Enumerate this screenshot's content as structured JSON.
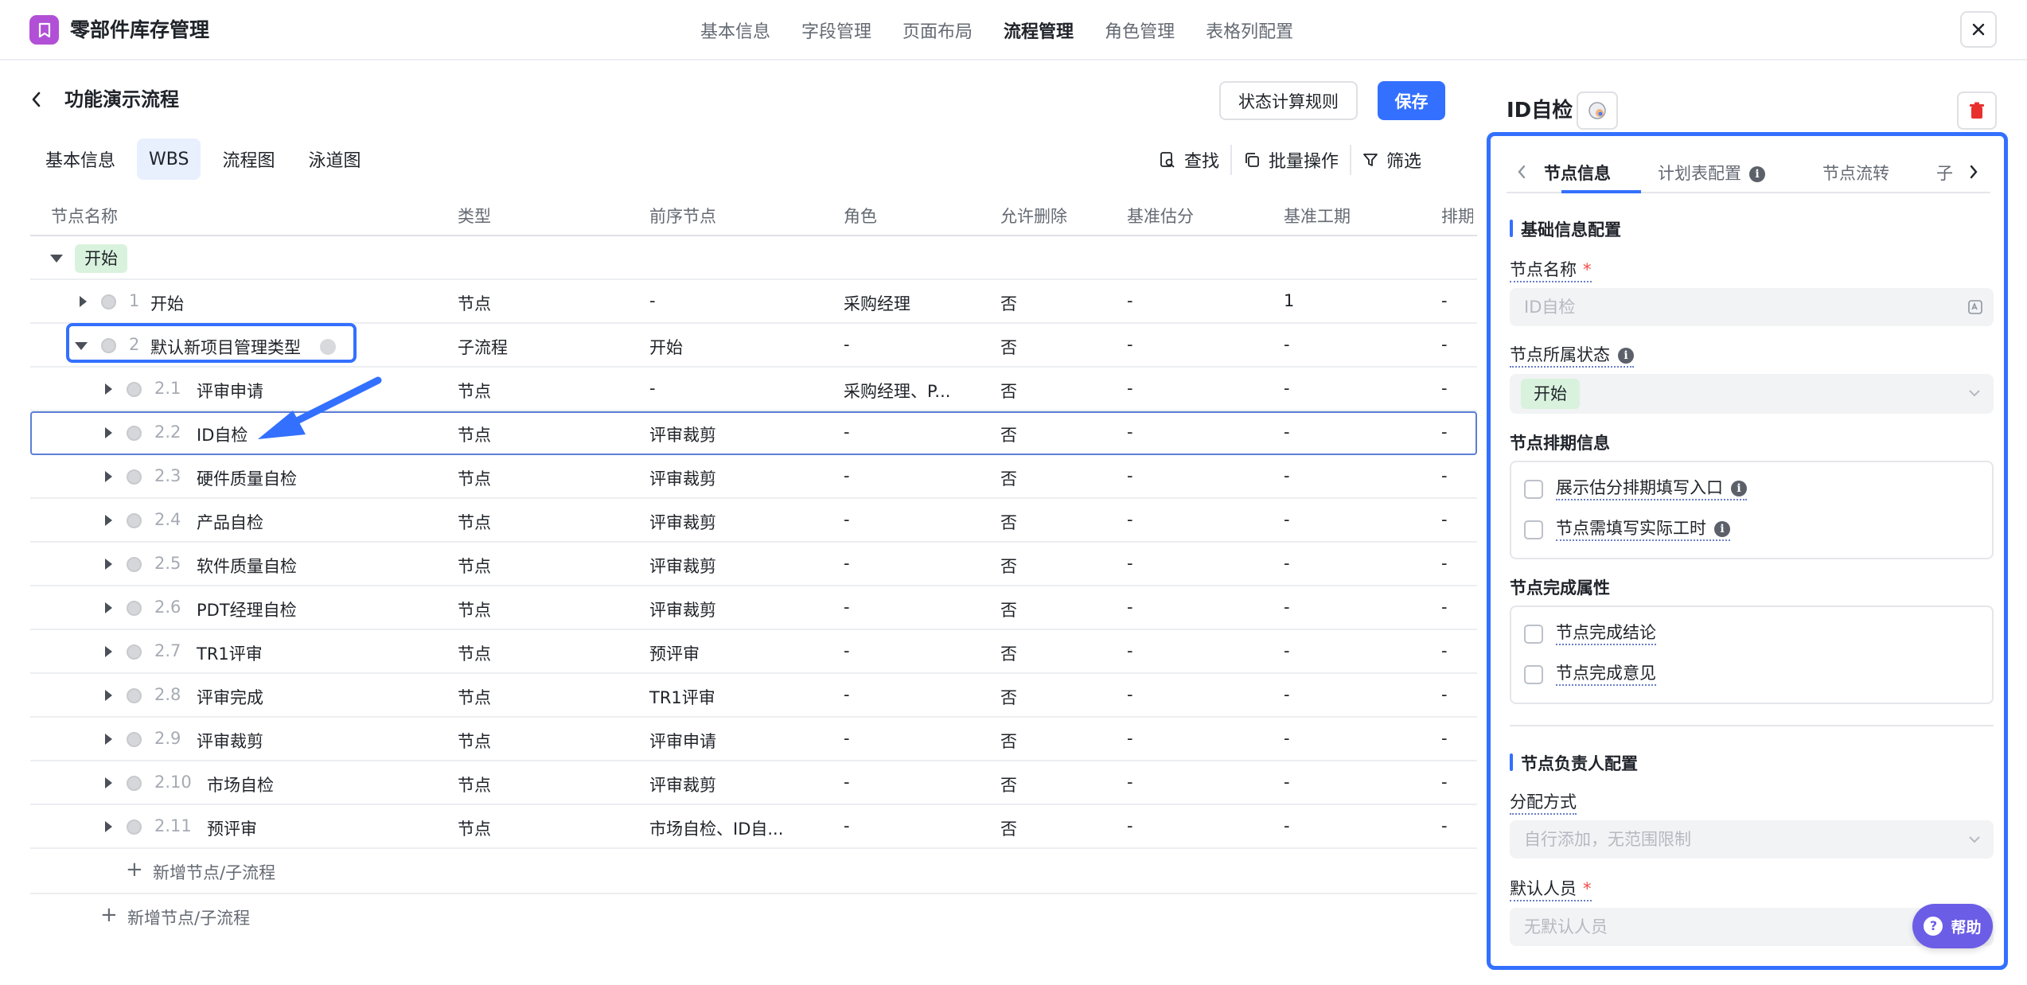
{
  "app": {
    "title": "零部件库存管理"
  },
  "top_tabs": [
    {
      "label": "基本信息",
      "active": false
    },
    {
      "label": "字段管理",
      "active": false
    },
    {
      "label": "页面布局",
      "active": false
    },
    {
      "label": "流程管理",
      "active": true
    },
    {
      "label": "角色管理",
      "active": false
    },
    {
      "label": "表格列配置",
      "active": false
    }
  ],
  "page": {
    "title": "功能演示流程",
    "rules_button": "状态计算规则",
    "save_button": "保存"
  },
  "sub_tabs": [
    {
      "label": "基本信息",
      "active": false
    },
    {
      "label": "WBS",
      "active": true
    },
    {
      "label": "流程图",
      "active": false
    },
    {
      "label": "泳道图",
      "active": false
    }
  ],
  "toolbar": {
    "find": "查找",
    "batch": "批量操作",
    "filter": "筛选"
  },
  "table": {
    "headers": [
      "节点名称",
      "类型",
      "前序节点",
      "角色",
      "允许删除",
      "基准估分",
      "基准工期",
      "排期"
    ],
    "stage_tag": "开始",
    "rows": [
      {
        "idx": "1",
        "name": "开始",
        "type": "节点",
        "prev": "-",
        "role": "采购经理",
        "del": "否",
        "score": "-",
        "dur": "1",
        "sched": "-",
        "level": 1,
        "expanded": false
      },
      {
        "idx": "2",
        "name": "默认新项目管理类型",
        "type": "子流程",
        "prev": "开始",
        "role": "-",
        "del": "否",
        "score": "-",
        "dur": "-",
        "sched": "-",
        "level": 1,
        "expanded": true
      },
      {
        "idx": "2.1",
        "name": "评审申请",
        "type": "节点",
        "prev": "-",
        "role": "采购经理、P...",
        "del": "否",
        "score": "-",
        "dur": "-",
        "sched": "-",
        "level": 2
      },
      {
        "idx": "2.2",
        "name": "ID自检",
        "type": "节点",
        "prev": "评审裁剪",
        "role": "-",
        "del": "否",
        "score": "-",
        "dur": "-",
        "sched": "-",
        "level": 2,
        "selected": true
      },
      {
        "idx": "2.3",
        "name": "硬件质量自检",
        "type": "节点",
        "prev": "评审裁剪",
        "role": "-",
        "del": "否",
        "score": "-",
        "dur": "-",
        "sched": "-",
        "level": 2
      },
      {
        "idx": "2.4",
        "name": "产品自检",
        "type": "节点",
        "prev": "评审裁剪",
        "role": "-",
        "del": "否",
        "score": "-",
        "dur": "-",
        "sched": "-",
        "level": 2
      },
      {
        "idx": "2.5",
        "name": "软件质量自检",
        "type": "节点",
        "prev": "评审裁剪",
        "role": "-",
        "del": "否",
        "score": "-",
        "dur": "-",
        "sched": "-",
        "level": 2
      },
      {
        "idx": "2.6",
        "name": "PDT经理自检",
        "type": "节点",
        "prev": "评审裁剪",
        "role": "-",
        "del": "否",
        "score": "-",
        "dur": "-",
        "sched": "-",
        "level": 2
      },
      {
        "idx": "2.7",
        "name": "TR1评审",
        "type": "节点",
        "prev": "预评审",
        "role": "-",
        "del": "否",
        "score": "-",
        "dur": "-",
        "sched": "-",
        "level": 2
      },
      {
        "idx": "2.8",
        "name": "评审完成",
        "type": "节点",
        "prev": "TR1评审",
        "role": "-",
        "del": "否",
        "score": "-",
        "dur": "-",
        "sched": "-",
        "level": 2
      },
      {
        "idx": "2.9",
        "name": "评审裁剪",
        "type": "节点",
        "prev": "评审申请",
        "role": "-",
        "del": "否",
        "score": "-",
        "dur": "-",
        "sched": "-",
        "level": 2
      },
      {
        "idx": "2.10",
        "name": "市场自检",
        "type": "节点",
        "prev": "评审裁剪",
        "role": "-",
        "del": "否",
        "score": "-",
        "dur": "-",
        "sched": "-",
        "level": 2
      },
      {
        "idx": "2.11",
        "name": "预评审",
        "type": "节点",
        "prev": "市场自检、ID自...",
        "role": "-",
        "del": "否",
        "score": "-",
        "dur": "-",
        "sched": "-",
        "level": 2
      }
    ],
    "add_child": "新增节点/子流程",
    "add_root": "新增节点/子流程"
  },
  "panel": {
    "title": "ID自检",
    "tabs": [
      "节点信息",
      "计划表配置",
      "节点流转",
      "子"
    ],
    "section_basic": "基础信息配置",
    "name_label": "节点名称",
    "name_value": "ID自检",
    "status_label": "节点所属状态",
    "status_value": "开始",
    "schedule_title": "节点排期信息",
    "schedule_opts": [
      "展示估分排期填写入口",
      "节点需填写实际工时"
    ],
    "complete_title": "节点完成属性",
    "complete_opts": [
      "节点完成结论",
      "节点完成意见"
    ],
    "section_owner": "节点负责人配置",
    "assign_label": "分配方式",
    "assign_value": "自行添加，无范围限制",
    "default_label": "默认人员",
    "default_value": "无默认人员",
    "help": "帮助"
  }
}
